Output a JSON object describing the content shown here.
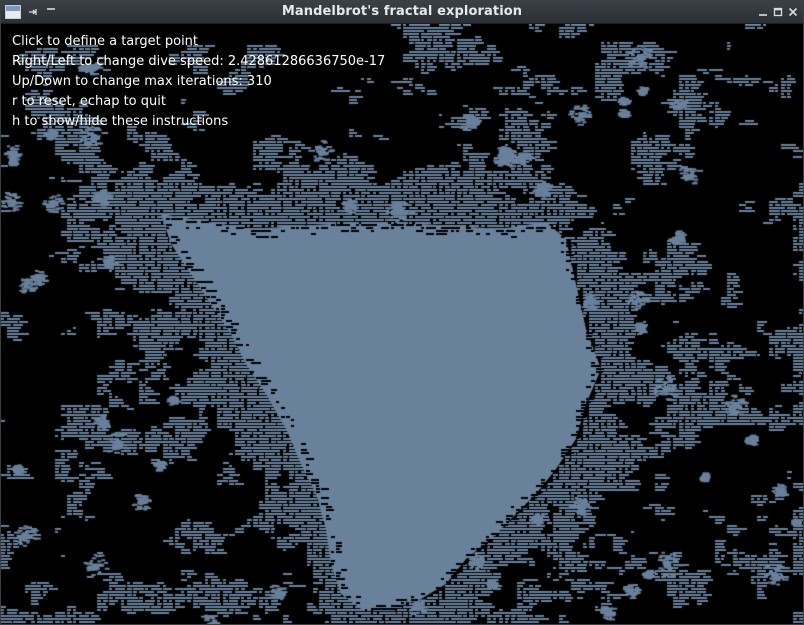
{
  "window": {
    "title": "Mandelbrot's fractal exploration",
    "icons": {
      "app": "app-window-icon",
      "pin": "pin-icon",
      "shade": "shade-icon",
      "minimize": "minimize-icon",
      "maximize": "maximize-icon",
      "close": "close-icon"
    }
  },
  "instructions": [
    "Click to define a target point",
    "Right/Left to change dive speed: 2.42861286636750e-17",
    "Up/Down to change max iterations: 310",
    "r to reset, echap to quit",
    "h to show/hide these instructions"
  ],
  "fractal": {
    "background_color": "#000000",
    "set_color": "#6a819c",
    "text_color": "#ffffff"
  }
}
